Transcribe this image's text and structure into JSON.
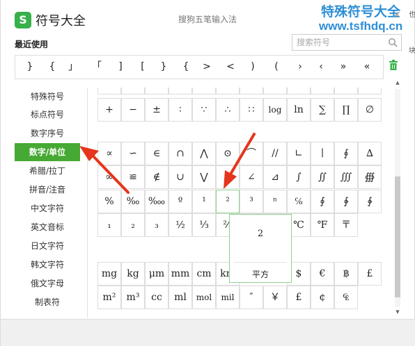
{
  "window": {
    "logo": "S",
    "title": "符号大全",
    "ime_name": "搜狗五笔输入法"
  },
  "watermark": {
    "line1": "特殊符号大全",
    "line2": "www.tsfhdq.cn",
    "close": "✕"
  },
  "edge_text": [
    "也",
    "块"
  ],
  "recent": {
    "label": "最近使用",
    "items": [
      "}",
      "{",
      "」",
      "「",
      "]",
      "[",
      "}",
      "{",
      ">",
      "<",
      ")",
      "(",
      "›",
      "‹",
      "»",
      "«",
      "]"
    ]
  },
  "search": {
    "placeholder": "搜索符号",
    "value": ""
  },
  "sidebar": {
    "active_index": 3,
    "categories": [
      "特殊符号",
      "标点符号",
      "数字序号",
      "数字/单位",
      "希腊/拉丁",
      "拼音/注音",
      "中文字符",
      "英文音标",
      "日文字符",
      "韩文字符",
      "俄文字母",
      "制表符"
    ]
  },
  "grid": {
    "rows": [
      [
        "",
        "",
        "",
        "",
        "",
        "",
        "",
        "",
        "",
        "",
        "",
        "",
        ""
      ],
      [
        "+",
        "−",
        "±",
        "∶",
        "∵",
        "∴",
        "∷",
        "log",
        "ln",
        "∑",
        "∏",
        "∅"
      ],
      [
        "∝",
        "∽",
        "∈",
        "∩",
        "⋀",
        "⊙",
        "⌒",
        "//",
        "∟",
        "∣",
        "∮",
        "∆"
      ],
      [
        "∞",
        "≌",
        "∉",
        "∪",
        "⋁",
        "⊥",
        "∠",
        "⊿",
        "∫",
        "∬",
        "∭",
        "∰"
      ],
      [
        "%",
        "‰",
        "‱",
        "º",
        "¹",
        "²",
        "³",
        "ⁿ",
        "℅",
        "∮",
        "∲",
        "∳"
      ],
      [
        "₁",
        "₂",
        "₃",
        "½",
        "⅓",
        "⅔",
        "⅛",
        "°",
        "℃",
        "℉",
        "〒",
        ""
      ],
      [
        "mg",
        "kg",
        "μm",
        "mm",
        "cm",
        "km",
        "",
        "",
        "$",
        "€",
        "฿",
        "£"
      ],
      [
        "m²",
        "m³",
        "cc",
        "ml",
        "mol",
        "mil",
        "″",
        "￥",
        "£",
        "¢",
        "₠",
        ""
      ]
    ]
  },
  "popup": {
    "char": "2",
    "name": "平方"
  }
}
